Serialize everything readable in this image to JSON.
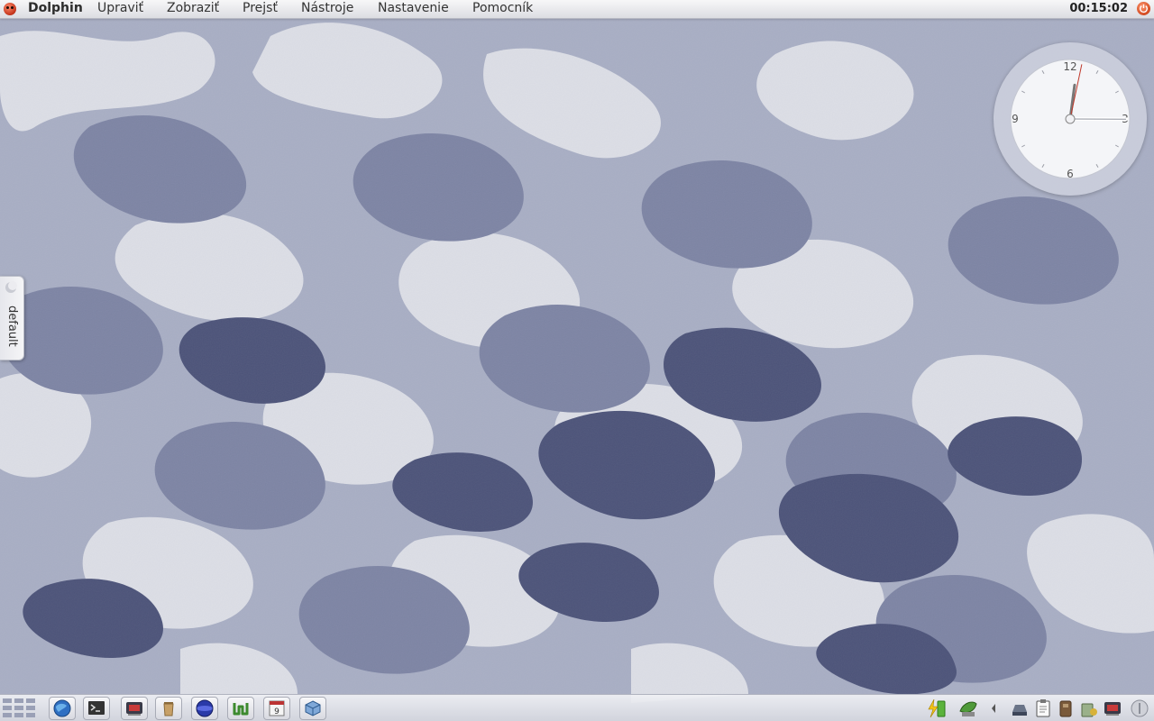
{
  "menubar": {
    "app_name": "Dolphin",
    "menus": [
      "Upraviť",
      "Zobraziť",
      "Prejsť",
      "Nástroje",
      "Nastavenie",
      "Pomocník"
    ],
    "clock": "00:15:02"
  },
  "clock_widget": {
    "numerals": [
      "12",
      "3",
      "6",
      "9"
    ],
    "time": {
      "hour": 0,
      "minute": 15,
      "second": 2
    }
  },
  "activity": {
    "label": "default"
  },
  "panel": {
    "launchers": [
      {
        "icon": "app-launcher-grid-icon"
      },
      {
        "icon": "browser-globe-icon"
      },
      {
        "icon": "terminal-icon"
      },
      {
        "icon": "screen-capture-icon"
      },
      {
        "icon": "trash-can-icon"
      },
      {
        "icon": "media-player-icon"
      },
      {
        "icon": "network-manager-icon"
      },
      {
        "icon": "calendar-icon"
      },
      {
        "icon": "virtualbox-icon"
      }
    ],
    "calendar_day": "9",
    "tray": [
      {
        "icon": "battery-charging-icon"
      },
      {
        "icon": "updates-leaf-icon"
      },
      {
        "icon": "tray-expand-arrow-icon"
      },
      {
        "icon": "network-icon"
      },
      {
        "icon": "clipboard-icon"
      },
      {
        "icon": "device-notifier-icon"
      },
      {
        "icon": "volume-icon"
      },
      {
        "icon": "screen-recorder-icon"
      },
      {
        "icon": "panel-toolbox-icon"
      }
    ]
  },
  "colors": {
    "menubar_bg": "#e8e9ee",
    "camo_light": "#d9dbe3",
    "camo_mid": "#a8aec4",
    "camo_dark": "#6b7293",
    "camo_darkest": "#454b70",
    "accent_red": "#d24a20"
  }
}
